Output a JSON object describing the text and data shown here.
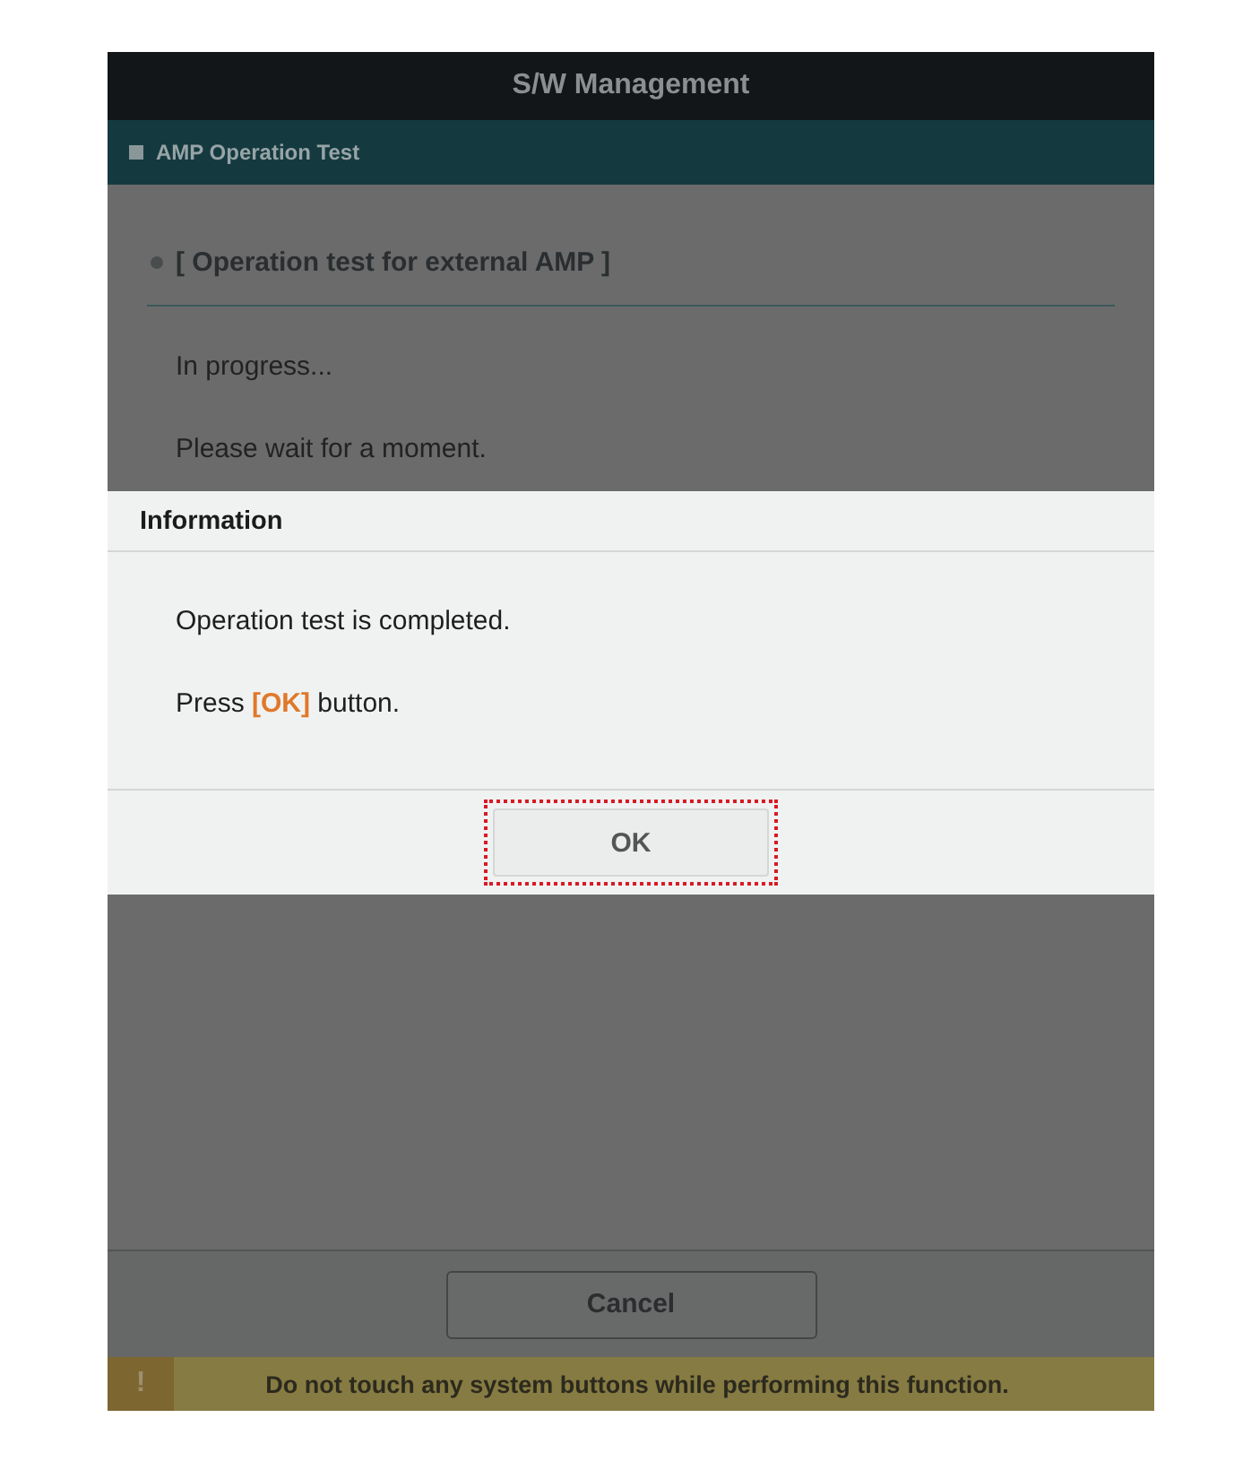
{
  "window": {
    "title": "S/W Management"
  },
  "section": {
    "title": "AMP Operation Test"
  },
  "content": {
    "heading": "[ Operation test for external AMP ]",
    "lines": [
      "In progress...",
      "Please wait for a moment."
    ]
  },
  "dialog": {
    "title": "Information",
    "lines": [
      "Operation test is completed.",
      "Press **[OK]** button."
    ],
    "button": "OK",
    "highlighted": true
  },
  "footer": {
    "button": "Cancel"
  },
  "warning": {
    "icon": "!",
    "text": "Do not touch any system buttons while performing this function."
  }
}
